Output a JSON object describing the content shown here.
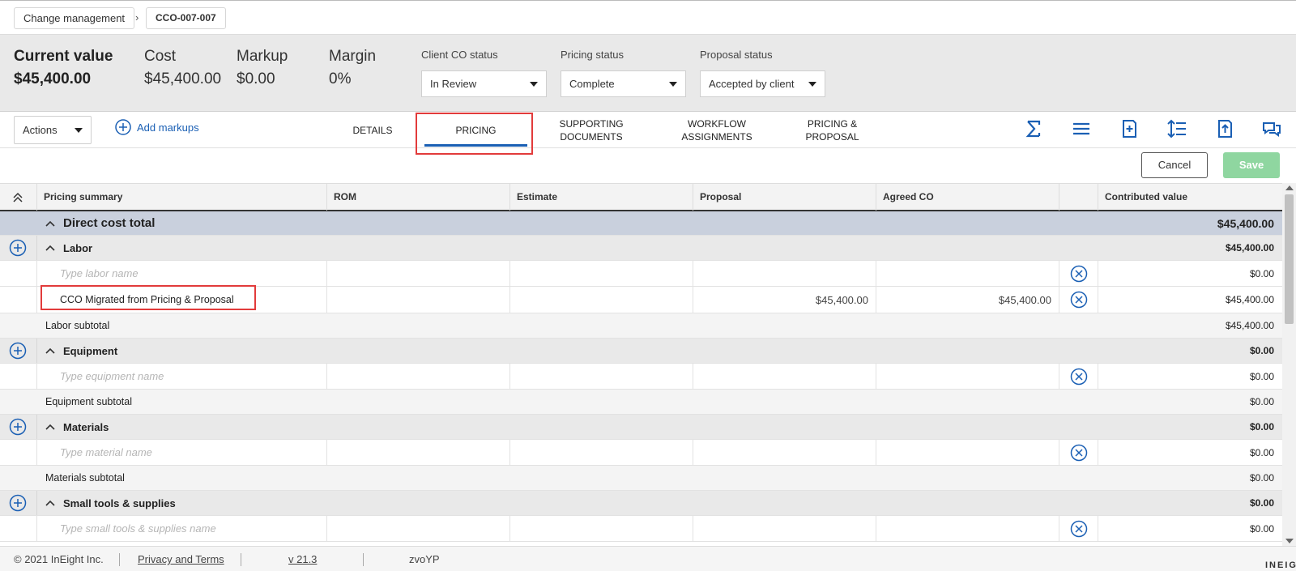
{
  "breadcrumb": {
    "parent": "Change management",
    "current": "CCO-007-007"
  },
  "summary": {
    "current_value_label": "Current value",
    "current_value": "$45,400.00",
    "cost_label": "Cost",
    "cost": "$45,400.00",
    "markup_label": "Markup",
    "markup": "$0.00",
    "margin_label": "Margin",
    "margin": "0%",
    "client_co_status_label": "Client CO status",
    "client_co_status": "In Review",
    "pricing_status_label": "Pricing status",
    "pricing_status": "Complete",
    "proposal_status_label": "Proposal status",
    "proposal_status": "Accepted by client"
  },
  "toolbar": {
    "actions_label": "Actions",
    "add_markups_label": "Add markups",
    "tabs": [
      {
        "line1": "DETAILS",
        "line2": ""
      },
      {
        "line1": "PRICING",
        "line2": ""
      },
      {
        "line1": "SUPPORTING",
        "line2": "DOCUMENTS"
      },
      {
        "line1": "WORKFLOW",
        "line2": "ASSIGNMENTS"
      },
      {
        "line1": "PRICING &",
        "line2": "PROPOSAL"
      }
    ],
    "active_tab": "PRICING",
    "icons": [
      "sigma-icon",
      "list-icon",
      "add-document-icon",
      "row-height-icon",
      "upload-document-icon",
      "comments-icon"
    ],
    "cancel_label": "Cancel",
    "save_label": "Save"
  },
  "grid": {
    "headers": {
      "pricing_summary": "Pricing summary",
      "rom": "ROM",
      "estimate": "Estimate",
      "proposal": "Proposal",
      "agreed_co": "Agreed CO",
      "contributed_value": "Contributed value"
    },
    "direct_cost_total": {
      "label": "Direct cost total",
      "value": "$45,400.00"
    },
    "labor": {
      "label": "Labor",
      "value": "$45,400.00",
      "placeholder": "Type labor name",
      "placeholder_value": "$0.00",
      "item": {
        "name": "CCO Migrated from Pricing & Proposal",
        "proposal": "$45,400.00",
        "agreed_co": "$45,400.00",
        "value": "$45,400.00"
      },
      "subtotal_label": "Labor subtotal",
      "subtotal": "$45,400.00"
    },
    "equipment": {
      "label": "Equipment",
      "value": "$0.00",
      "placeholder": "Type equipment name",
      "placeholder_value": "$0.00",
      "subtotal_label": "Equipment subtotal",
      "subtotal": "$0.00"
    },
    "materials": {
      "label": "Materials",
      "value": "$0.00",
      "placeholder": "Type material name",
      "placeholder_value": "$0.00",
      "subtotal_label": "Materials subtotal",
      "subtotal": "$0.00"
    },
    "small_tools": {
      "label": "Small tools & supplies",
      "value": "$0.00",
      "placeholder": "Type small tools & supplies name",
      "placeholder_value": "$0.00"
    }
  },
  "footer": {
    "copyright": "© 2021 InEight Inc.",
    "privacy": "Privacy and Terms",
    "version": "v 21.3",
    "code": "zvoYP",
    "brand": "INEIGHT"
  },
  "colors": {
    "accent": "#1a5fb4",
    "highlight": "#e23b3b",
    "save_disabled": "#8fd6a0"
  }
}
